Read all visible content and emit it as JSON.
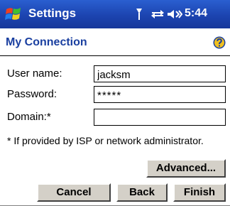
{
  "titlebar": {
    "app_title": "Settings",
    "clock": "5:44",
    "icons": [
      "windows-start-icon",
      "antenna-icon",
      "sync-icon",
      "speaker-icon"
    ]
  },
  "page": {
    "title": "My Connection",
    "help_icon": "help-icon"
  },
  "form": {
    "username_label": "User name:",
    "username_value": "jacksm",
    "password_label": "Password:",
    "password_value": "*****",
    "domain_label": "Domain:*",
    "domain_value": ""
  },
  "note": "* If provided by ISP or network administrator.",
  "buttons": {
    "advanced": "Advanced...",
    "cancel": "Cancel",
    "back": "Back",
    "finish": "Finish"
  },
  "colors": {
    "titlebar": "#1c44b0",
    "page_title": "#1a3fa0",
    "button_face": "#d4d0c8"
  }
}
